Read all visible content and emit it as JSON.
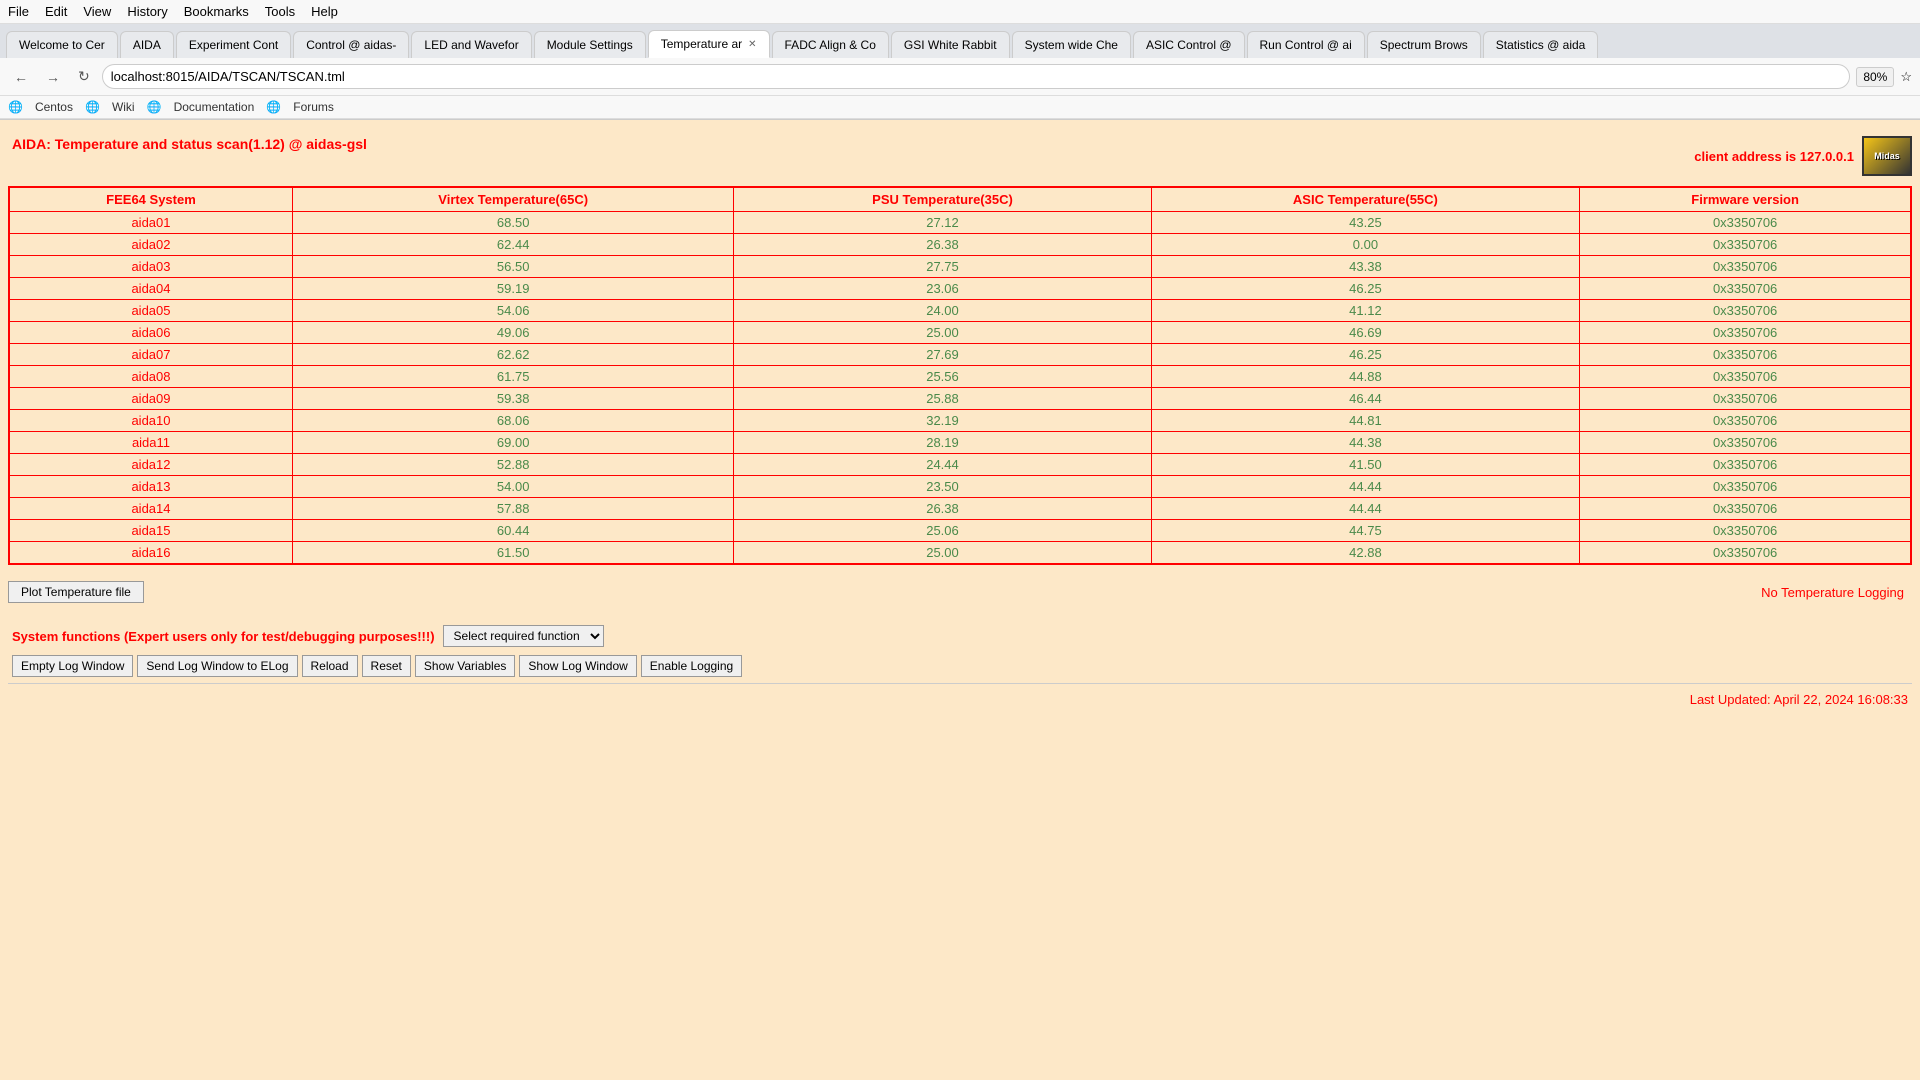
{
  "browser": {
    "menu": [
      "File",
      "Edit",
      "View",
      "History",
      "Bookmarks",
      "Tools",
      "Help"
    ],
    "tabs": [
      {
        "label": "Welcome to Cer",
        "active": false,
        "closable": false
      },
      {
        "label": "AIDA",
        "active": false,
        "closable": false
      },
      {
        "label": "Experiment Cont",
        "active": false,
        "closable": false
      },
      {
        "label": "Control @ aidas-",
        "active": false,
        "closable": false
      },
      {
        "label": "LED and Wavefor",
        "active": false,
        "closable": false
      },
      {
        "label": "Module Settings",
        "active": false,
        "closable": false
      },
      {
        "label": "Temperature ar",
        "active": true,
        "closable": true
      },
      {
        "label": "FADC Align & Co",
        "active": false,
        "closable": false
      },
      {
        "label": "GSI White Rabbit",
        "active": false,
        "closable": false
      },
      {
        "label": "System wide Che",
        "active": false,
        "closable": false
      },
      {
        "label": "ASIC Control @",
        "active": false,
        "closable": false
      },
      {
        "label": "Run Control @ ai",
        "active": false,
        "closable": false
      },
      {
        "label": "Spectrum Brows",
        "active": false,
        "closable": false
      },
      {
        "label": "Statistics @ aida",
        "active": false,
        "closable": false
      }
    ],
    "url": "localhost:8015/AIDA/TSCAN/TSCAN.tml",
    "zoom": "80%",
    "bookmarks": [
      "Centos",
      "Wiki",
      "Documentation",
      "Forums"
    ]
  },
  "page": {
    "title": "AIDA: Temperature and status scan(1.12) @ aidas-gsl",
    "client_address_label": "client address is 127.0.0.1",
    "table": {
      "headers": [
        "FEE64 System",
        "Virtex Temperature(65C)",
        "PSU Temperature(35C)",
        "ASIC Temperature(55C)",
        "Firmware version"
      ],
      "rows": [
        [
          "aida01",
          "68.50",
          "27.12",
          "43.25",
          "0x3350706"
        ],
        [
          "aida02",
          "62.44",
          "26.38",
          "0.00",
          "0x3350706"
        ],
        [
          "aida03",
          "56.50",
          "27.75",
          "43.38",
          "0x3350706"
        ],
        [
          "aida04",
          "59.19",
          "23.06",
          "46.25",
          "0x3350706"
        ],
        [
          "aida05",
          "54.06",
          "24.00",
          "41.12",
          "0x3350706"
        ],
        [
          "aida06",
          "49.06",
          "25.00",
          "46.69",
          "0x3350706"
        ],
        [
          "aida07",
          "62.62",
          "27.69",
          "46.25",
          "0x3350706"
        ],
        [
          "aida08",
          "61.75",
          "25.56",
          "44.88",
          "0x3350706"
        ],
        [
          "aida09",
          "59.38",
          "25.88",
          "46.44",
          "0x3350706"
        ],
        [
          "aida10",
          "68.06",
          "32.19",
          "44.81",
          "0x3350706"
        ],
        [
          "aida11",
          "69.00",
          "28.19",
          "44.38",
          "0x3350706"
        ],
        [
          "aida12",
          "52.88",
          "24.44",
          "41.50",
          "0x3350706"
        ],
        [
          "aida13",
          "54.00",
          "23.50",
          "44.44",
          "0x3350706"
        ],
        [
          "aida14",
          "57.88",
          "26.38",
          "44.44",
          "0x3350706"
        ],
        [
          "aida15",
          "60.44",
          "25.06",
          "44.75",
          "0x3350706"
        ],
        [
          "aida16",
          "61.50",
          "25.00",
          "42.88",
          "0x3350706"
        ]
      ]
    },
    "plot_btn_label": "Plot Temperature file",
    "no_logging_label": "No Temperature Logging",
    "system_functions_label": "System functions (Expert users only for test/debugging purposes!!!)",
    "select_function_label": "Select required function",
    "buttons": [
      "Empty Log Window",
      "Send Log Window to ELog",
      "Reload",
      "Reset",
      "Show Variables",
      "Show Log Window",
      "Enable Logging"
    ],
    "last_updated": "Last Updated: April 22, 2024 16:08:33"
  }
}
